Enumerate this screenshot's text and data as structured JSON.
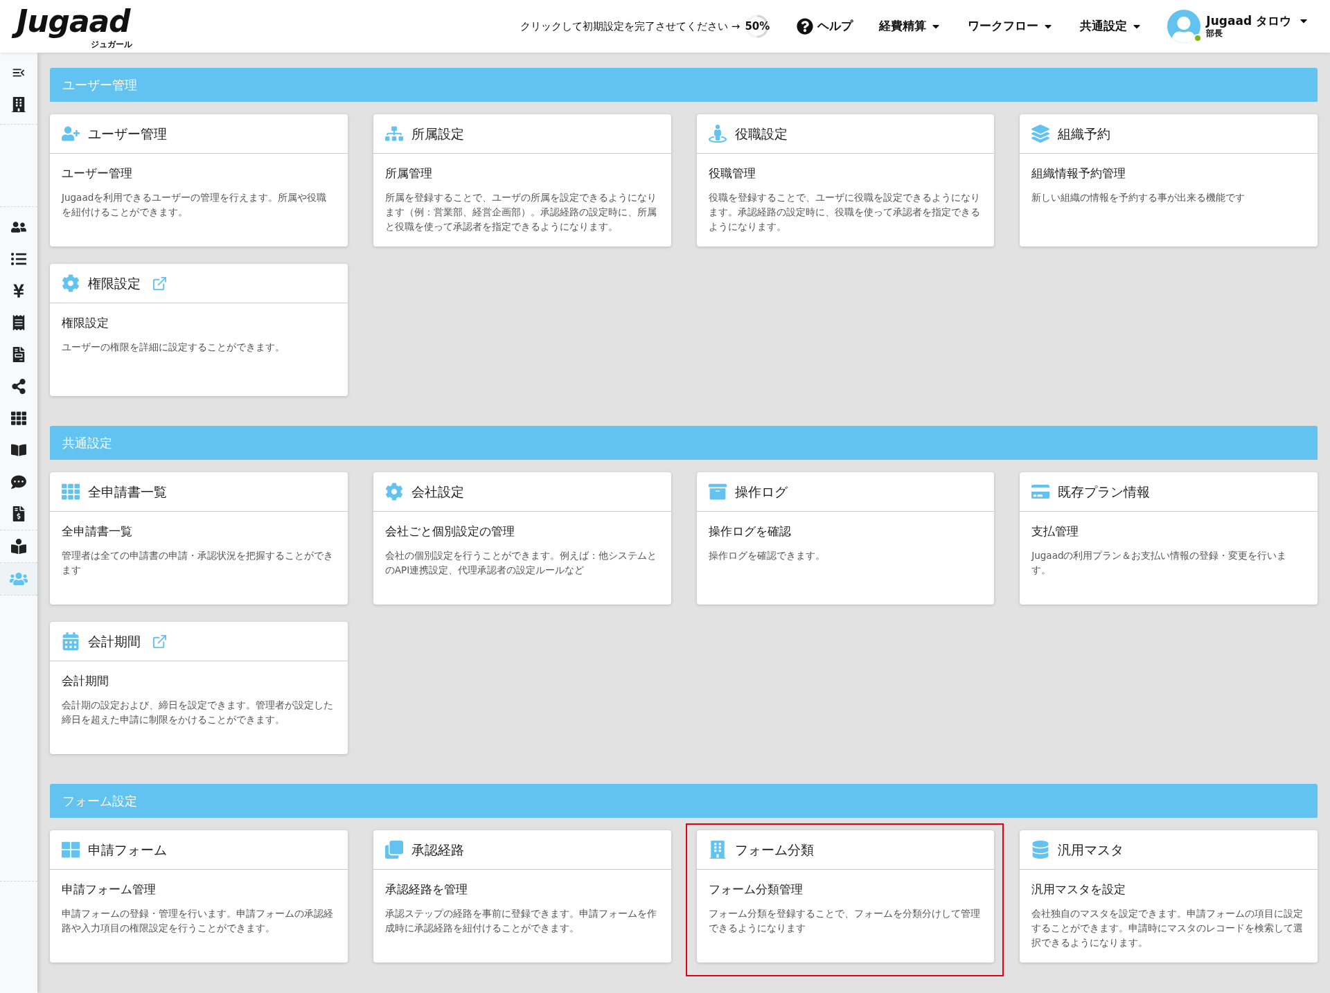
{
  "header": {
    "logo": {
      "text": "Jugaad",
      "subtext": "ジュガール"
    },
    "setup_prompt": {
      "text": "クリックして初期設定を完了させてください →",
      "progress": {
        "label": "50%",
        "level": 0.5
      }
    },
    "nav": [
      {
        "label": "ヘルプ",
        "kind": "help"
      },
      {
        "label": "経費精算",
        "kind": "menu"
      },
      {
        "label": "ワークフロー",
        "kind": "menu"
      },
      {
        "label": "共通設定",
        "kind": "menu"
      }
    ],
    "user": {
      "name": "Jugaad タロウ",
      "role": "部長",
      "online": true
    }
  },
  "sidebar": {
    "items": [
      {
        "selected": false
      },
      {
        "selected": false
      },
      {
        "selected": false
      },
      {
        "selected": false
      },
      {
        "selected": false
      },
      {
        "selected": false
      },
      {
        "selected": false
      },
      {
        "selected": false
      },
      {
        "selected": false
      },
      {
        "selected": false
      },
      {
        "selected": false
      },
      {
        "selected": false
      },
      {
        "selected": false
      },
      {
        "selected": true
      }
    ]
  },
  "sections": [
    {
      "title": "ユーザー管理",
      "cards": [
        {
          "title": "ユーザー管理",
          "external": false,
          "highlighted": false,
          "subtitle": "ユーザー管理",
          "description": "Jugaadを利用できるユーザーの管理を行えます。所属や役職を紐付けることができます。"
        },
        {
          "title": "所属設定",
          "external": false,
          "highlighted": false,
          "subtitle": "所属管理",
          "description": "所属を登録することで、ユーザの所属を設定できるようになります（例：営業部、経営企画部）。承認経路の設定時に、所属と役職を使って承認者を指定できるようになります。"
        },
        {
          "title": "役職設定",
          "external": false,
          "highlighted": false,
          "subtitle": "役職管理",
          "description": "役職を登録することで、ユーザに役職を設定できるようになります。承認経路の設定時に、役職を使って承認者を指定できるようになります。"
        },
        {
          "title": "組織予約",
          "external": false,
          "highlighted": false,
          "subtitle": "組織情報予約管理",
          "description": "新しい組織の情報を予約する事が出来る機能です"
        },
        {
          "title": "権限設定",
          "external": true,
          "highlighted": false,
          "subtitle": "権限設定",
          "description": "ユーザーの権限を詳細に設定することができます。"
        }
      ]
    },
    {
      "title": "共通設定",
      "cards": [
        {
          "title": "全申請書一覧",
          "external": false,
          "highlighted": false,
          "subtitle": "全申請書一覧",
          "description": "管理者は全ての申請書の申請・承認状況を把握することができます"
        },
        {
          "title": "会社設定",
          "external": false,
          "highlighted": false,
          "subtitle": "会社ごと個別設定の管理",
          "description": "会社の個別設定を行うことができます。例えば：他システムとのAPI連携設定、代理承認者の設定ルールなど"
        },
        {
          "title": "操作ログ",
          "external": false,
          "highlighted": false,
          "subtitle": "操作ログを確認",
          "description": "操作ログを確認できます。"
        },
        {
          "title": "既存プラン情報",
          "external": false,
          "highlighted": false,
          "subtitle": "支払管理",
          "description": "Jugaadの利用プラン＆お支払い情報の登録・変更を行います。"
        },
        {
          "title": "会計期間",
          "external": true,
          "highlighted": false,
          "subtitle": "会計期間",
          "description": "会計期の設定および、締日を設定できます。管理者が設定した締日を超えた申請に制限をかけることができます。"
        }
      ]
    },
    {
      "title": "フォーム設定",
      "cards": [
        {
          "title": "申請フォーム",
          "external": false,
          "highlighted": false,
          "subtitle": "申請フォーム管理",
          "description": "申請フォームの登録・管理を行います。申請フォームの承認経路や入力項目の権限設定を行うことができます。"
        },
        {
          "title": "承認経路",
          "external": false,
          "highlighted": false,
          "subtitle": "承認経路を管理",
          "description": "承認ステップの経路を事前に登録できます。申請フォームを作成時に承認経路を紐付けることができます。"
        },
        {
          "title": "フォーム分類",
          "external": false,
          "highlighted": true,
          "subtitle": "フォーム分類管理",
          "description": "フォーム分類を登録することで、フォームを分類分けして管理できるようになります"
        },
        {
          "title": "汎用マスタ",
          "external": false,
          "highlighted": false,
          "subtitle": "汎用マスタを設定",
          "description": "会社独自のマスタを設定できます。申請フォームの項目に設定することができます。申請時にマスタのレコードを検索して選択できるようになります。"
        }
      ]
    }
  ]
}
